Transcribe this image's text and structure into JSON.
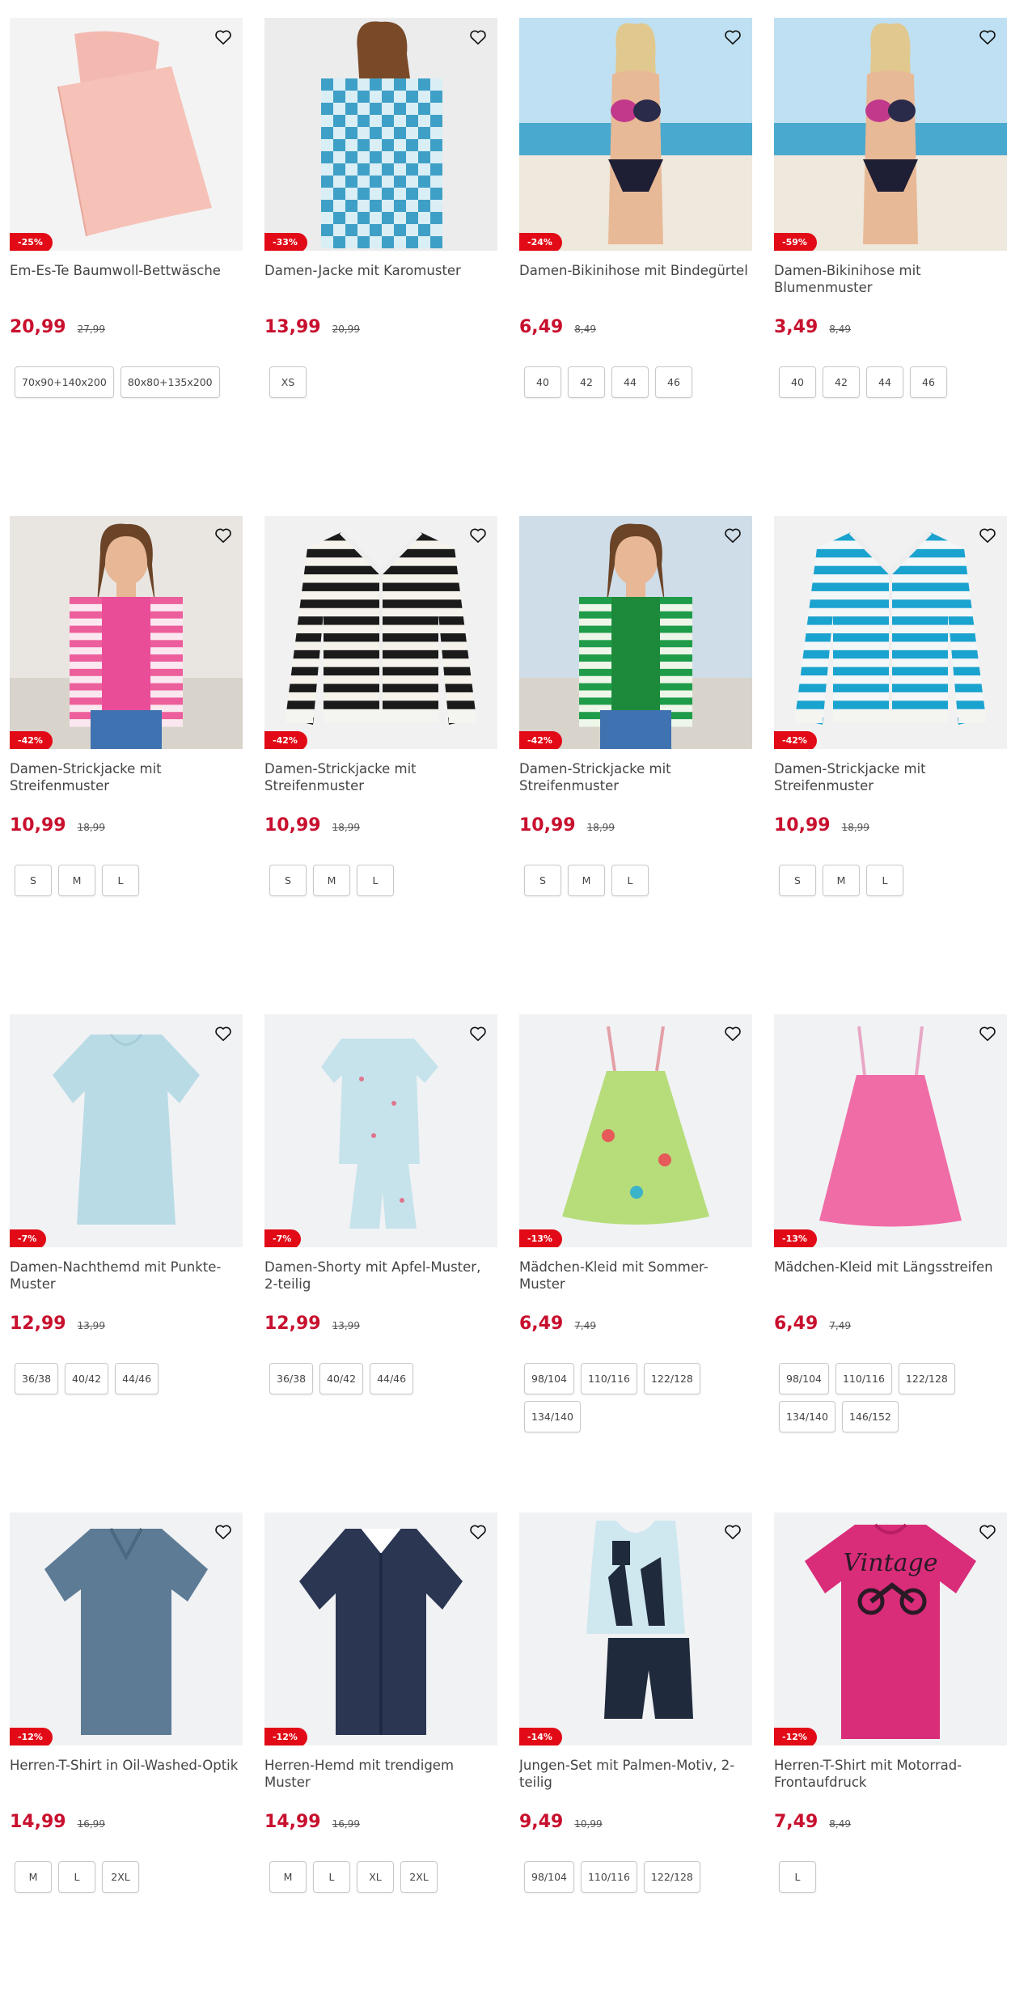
{
  "products": [
    {
      "title": "Em-Es-Te Baumwoll-Bettwäsche",
      "discount": "-25%",
      "price": "20,99",
      "old_price": "27,99",
      "sizes": [
        "70x90+140x200",
        "80x80+135x200"
      ],
      "art": "bedding"
    },
    {
      "title": "Damen-Jacke mit Karomuster",
      "discount": "-33%",
      "price": "13,99",
      "old_price": "20,99",
      "sizes": [
        "XS"
      ],
      "art": "plaid-jacket"
    },
    {
      "title": "Damen-Bikinihose mit Bindegürtel",
      "discount": "-24%",
      "price": "6,49",
      "old_price": "8,49",
      "sizes": [
        "40",
        "42",
        "44",
        "46"
      ],
      "art": "bikini-beach"
    },
    {
      "title": "Damen-Bikinihose mit Blumenmuster",
      "discount": "-59%",
      "price": "3,49",
      "old_price": "8,49",
      "sizes": [
        "40",
        "42",
        "44",
        "46"
      ],
      "art": "bikini-beach"
    },
    {
      "title": "Damen-Strickjacke mit Streifenmuster",
      "discount": "-42%",
      "price": "10,99",
      "old_price": "18,99",
      "sizes": [
        "S",
        "M",
        "L"
      ],
      "art": "cardigan-model-pink"
    },
    {
      "title": "Damen-Strickjacke mit Streifenmuster",
      "discount": "-42%",
      "price": "10,99",
      "old_price": "18,99",
      "sizes": [
        "S",
        "M",
        "L"
      ],
      "art": "cardigan-black"
    },
    {
      "title": "Damen-Strickjacke mit Streifenmuster",
      "discount": "-42%",
      "price": "10,99",
      "old_price": "18,99",
      "sizes": [
        "S",
        "M",
        "L"
      ],
      "art": "cardigan-model-green"
    },
    {
      "title": "Damen-Strickjacke mit Streifenmuster",
      "discount": "-42%",
      "price": "10,99",
      "old_price": "18,99",
      "sizes": [
        "S",
        "M",
        "L"
      ],
      "art": "cardigan-blue"
    },
    {
      "title": "Damen-Nachthemd mit Punkte-Muster",
      "discount": "-7%",
      "price": "12,99",
      "old_price": "13,99",
      "sizes": [
        "36/38",
        "40/42",
        "44/46"
      ],
      "art": "nightgown"
    },
    {
      "title": "Damen-Shorty mit Apfel-Muster, 2-teilig",
      "discount": "-7%",
      "price": "12,99",
      "old_price": "13,99",
      "sizes": [
        "36/38",
        "40/42",
        "44/46"
      ],
      "art": "shorty"
    },
    {
      "title": "Mädchen-Kleid mit Sommer-Muster",
      "discount": "-13%",
      "price": "6,49",
      "old_price": "7,49",
      "sizes": [
        "98/104",
        "110/116",
        "122/128",
        "134/140"
      ],
      "art": "dress-green"
    },
    {
      "title": "Mädchen-Kleid mit Längsstreifen",
      "discount": "-13%",
      "price": "6,49",
      "old_price": "7,49",
      "sizes": [
        "98/104",
        "110/116",
        "122/128",
        "134/140",
        "146/152"
      ],
      "art": "dress-pink"
    },
    {
      "title": "Herren-T-Shirt in Oil-Washed-Optik",
      "discount": "-12%",
      "price": "14,99",
      "old_price": "16,99",
      "sizes": [
        "M",
        "L",
        "2XL"
      ],
      "art": "tshirt-grey"
    },
    {
      "title": "Herren-Hemd mit trendigem Muster",
      "discount": "-12%",
      "price": "14,99",
      "old_price": "16,99",
      "sizes": [
        "M",
        "L",
        "XL",
        "2XL"
      ],
      "art": "shirt-navy"
    },
    {
      "title": "Jungen-Set mit Palmen-Motiv, 2-teilig",
      "discount": "-14%",
      "price": "9,49",
      "old_price": "10,99",
      "sizes": [
        "98/104",
        "110/116",
        "122/128"
      ],
      "art": "boys-set"
    },
    {
      "title": "Herren-T-Shirt mit Motorrad-Frontaufdruck",
      "discount": "-12%",
      "price": "7,49",
      "old_price": "8,49",
      "sizes": [
        "L"
      ],
      "art": "tshirt-pink",
      "art_text": "Vintage"
    }
  ],
  "colors": {
    "price": "#c8102e",
    "badge": "#e10a16",
    "image_bg": "#f1f2f4"
  },
  "icons": {
    "wishlist": "heart-outline-icon"
  }
}
